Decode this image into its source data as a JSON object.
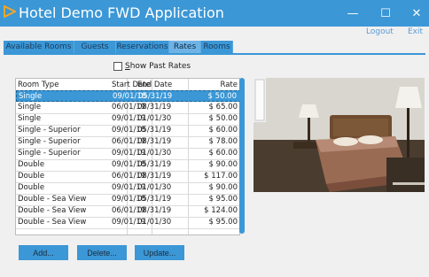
{
  "window": {
    "title": "Hotel Demo FWD Application",
    "minimize_glyph": "—",
    "maximize_glyph": "☐",
    "close_glyph": "✕"
  },
  "toplinks": {
    "logout": "Logout",
    "exit": "Exit"
  },
  "tabs": [
    {
      "label": "Available Rooms",
      "active": false
    },
    {
      "label": "Guests",
      "active": false
    },
    {
      "label": "Reservations",
      "active": false
    },
    {
      "label": "Rates",
      "active": true
    },
    {
      "label": "Rooms",
      "active": false
    }
  ],
  "filter": {
    "show_past_rates_label": "Show Past Rates",
    "checked": false
  },
  "rates_table": {
    "columns": [
      "Room Type",
      "Start Date",
      "End Date",
      "Rate"
    ],
    "rows": [
      {
        "type": "Single",
        "start": "09/01/18",
        "end": "05/31/19",
        "rate": "$ 50.00",
        "selected": true
      },
      {
        "type": "Single",
        "start": "06/01/19",
        "end": "08/31/19",
        "rate": "$ 65.00"
      },
      {
        "type": "Single",
        "start": "09/01/19",
        "end": "01/01/30",
        "rate": "$ 50.00"
      },
      {
        "type": "Single - Superior",
        "start": "09/01/18",
        "end": "05/31/19",
        "rate": "$ 60.00"
      },
      {
        "type": "Single - Superior",
        "start": "06/01/19",
        "end": "08/31/19",
        "rate": "$ 78.00"
      },
      {
        "type": "Single - Superior",
        "start": "09/01/19",
        "end": "01/01/30",
        "rate": "$ 60.00"
      },
      {
        "type": "Double",
        "start": "09/01/18",
        "end": "05/31/19",
        "rate": "$ 90.00"
      },
      {
        "type": "Double",
        "start": "06/01/19",
        "end": "08/31/19",
        "rate": "$ 117.00"
      },
      {
        "type": "Double",
        "start": "09/01/19",
        "end": "01/01/30",
        "rate": "$ 90.00"
      },
      {
        "type": "Double - Sea View",
        "start": "09/01/18",
        "end": "05/31/19",
        "rate": "$ 95.00"
      },
      {
        "type": "Double - Sea View",
        "start": "06/01/19",
        "end": "08/31/19",
        "rate": "$ 124.00"
      },
      {
        "type": "Double - Sea View",
        "start": "09/01/19",
        "end": "01/01/30",
        "rate": "$ 95.00"
      }
    ]
  },
  "buttons": {
    "add": "Add...",
    "delete": "Delete...",
    "update": "Update..."
  },
  "colors": {
    "accent": "#3b97d6",
    "title_logo": "#f6a623",
    "link": "#5a9bd5"
  },
  "icons": {
    "app_logo": "orange-triangle-logo"
  }
}
